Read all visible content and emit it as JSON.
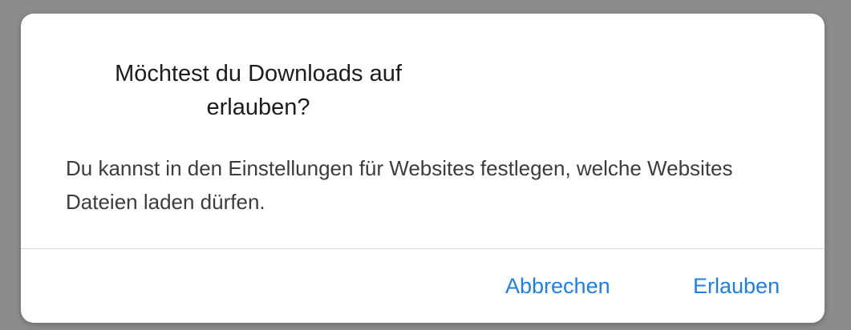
{
  "dialog": {
    "title": "Möchtest du Downloads auf erlauben?",
    "message": "Du kannst in den Einstellungen für Websites festlegen, welche Websites Dateien laden dürfen.",
    "buttons": {
      "cancel_label": "Abbrechen",
      "allow_label": "Erlauben"
    }
  },
  "colors": {
    "accent": "#1f7fe6",
    "backdrop": "#8c8c8c",
    "dialog_bg": "#ffffff",
    "title_text": "#1c1c1e",
    "body_text": "#3c3c3e",
    "divider": "#d8d8dc"
  }
}
